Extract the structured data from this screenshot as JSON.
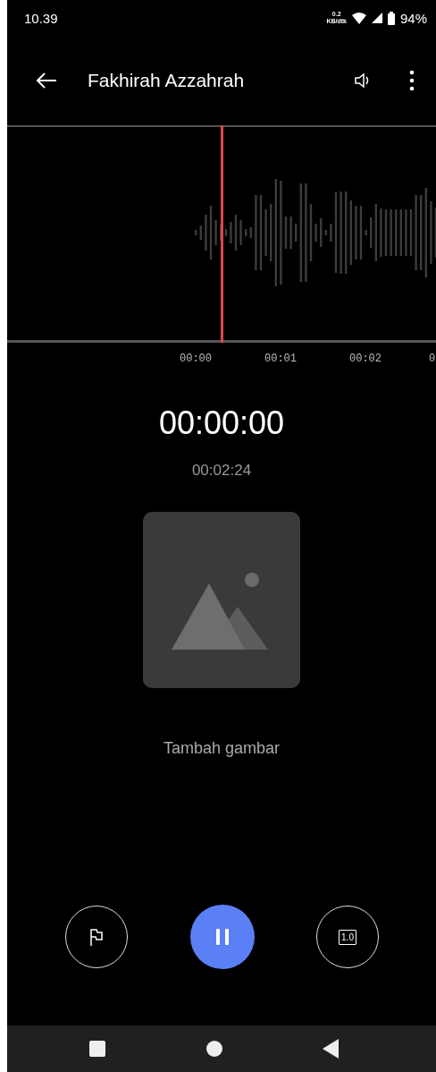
{
  "status_bar": {
    "time": "10.39",
    "net_speed_value": "0.2",
    "net_speed_unit": "KB/dtk",
    "battery": "94%"
  },
  "app_bar": {
    "title": "Fakhirah Azzahrah"
  },
  "timeline": {
    "ticks": [
      "00:00",
      "00:01",
      "00:02",
      "0"
    ]
  },
  "elapsed": "00:00:00",
  "duration": "00:02:24",
  "image_placeholder": {
    "label": "Tambah gambar"
  },
  "controls": {
    "speed": "1.0",
    "playing": true
  }
}
